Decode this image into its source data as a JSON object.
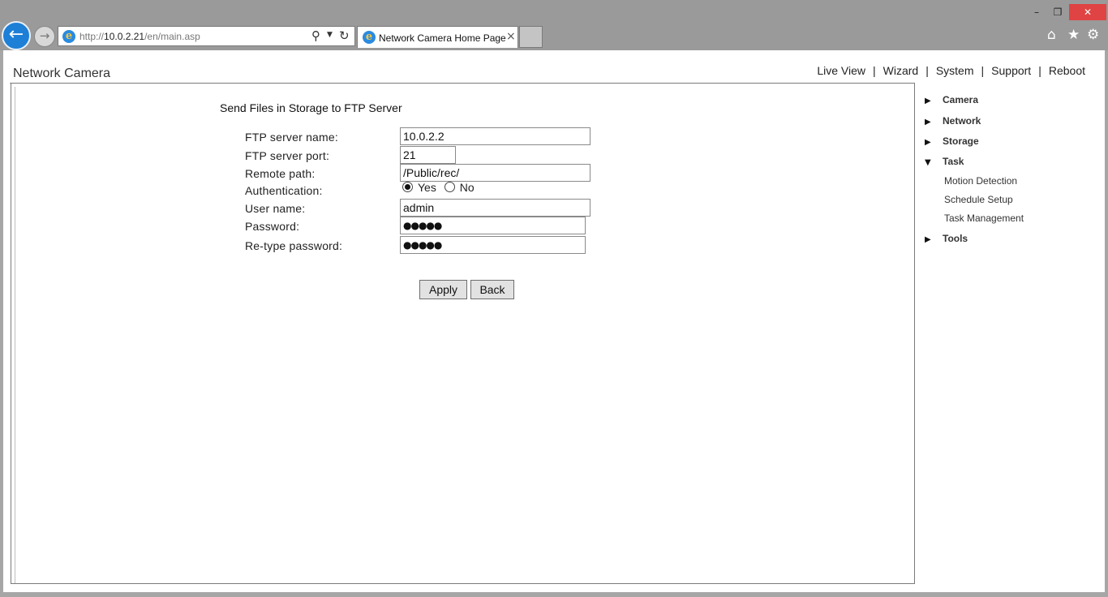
{
  "window": {
    "minimize": "–",
    "maximize": "❐",
    "close": "✕"
  },
  "browser": {
    "address_prefix": "http://",
    "address_host": "10.0.2.21",
    "address_path": "/en/main.asp",
    "tab_title": "Network Camera Home Page",
    "icons": [
      "back-arrow-icon",
      "forward-arrow-icon",
      "search-icon",
      "refresh-icon",
      "home-icon",
      "favorites-star-icon",
      "settings-gear-icon"
    ]
  },
  "header": {
    "brand": "Network Camera",
    "nav": [
      "Live View",
      "Wizard",
      "System",
      "Support",
      "Reboot"
    ],
    "separator": "|"
  },
  "form": {
    "title": "Send Files in Storage to FTP Server",
    "labels": {
      "server_name": "FTP server name:",
      "server_port": "FTP server port:",
      "remote_path": "Remote path:",
      "authentication": "Authentication:",
      "user_name": "User name:",
      "password": "Password:",
      "retype_password": "Re-type password:"
    },
    "values": {
      "server_name": "10.0.2.2",
      "server_port": "21",
      "remote_path": "/Public/rec/",
      "user_name": "admin",
      "password": "●●●●●",
      "retype_password": "●●●●●"
    },
    "auth_options": {
      "yes": "Yes",
      "no": "No",
      "selected": "Yes"
    },
    "buttons": {
      "apply": "Apply",
      "back": "Back"
    }
  },
  "sidebar": {
    "items": [
      {
        "label": "Camera",
        "expanded": false
      },
      {
        "label": "Network",
        "expanded": false
      },
      {
        "label": "Storage",
        "expanded": false
      },
      {
        "label": "Task",
        "expanded": true,
        "children": [
          "Motion Detection",
          "Schedule Setup",
          "Task Management"
        ]
      },
      {
        "label": "Tools",
        "expanded": false
      }
    ]
  }
}
